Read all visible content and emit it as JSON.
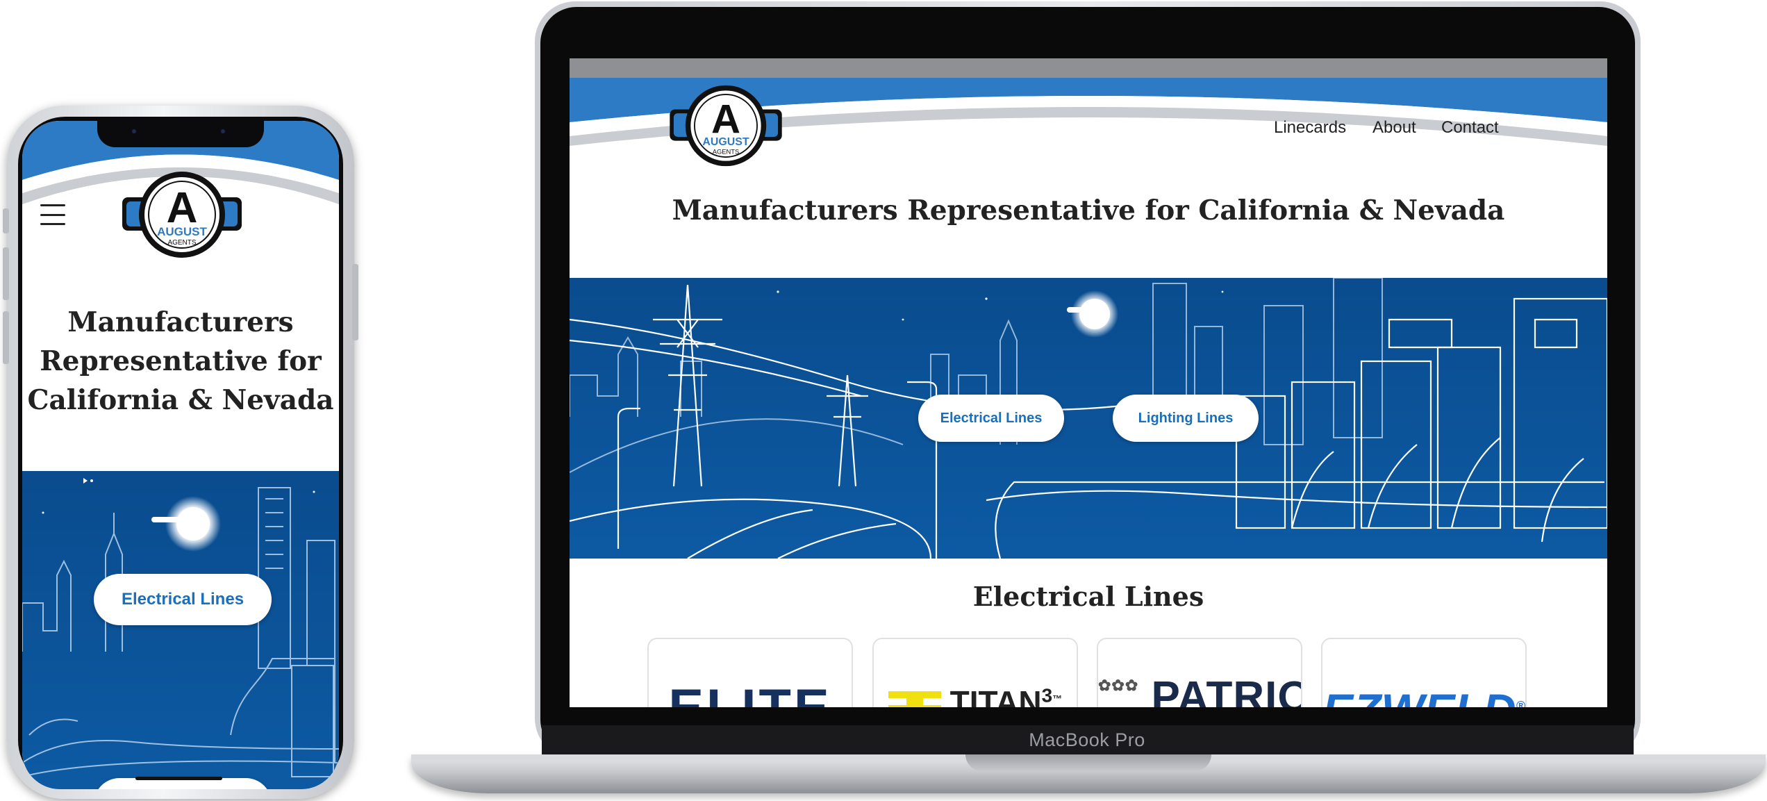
{
  "brand": {
    "letter": "A",
    "name": "AUGUST",
    "sub": "AGENTS"
  },
  "nav": {
    "links": [
      "Linecards",
      "About",
      "Contact"
    ]
  },
  "hero": {
    "title": "Manufacturers Representative for California & Nevada",
    "title_mobile_lines": [
      "Manufacturers",
      "Representative for",
      "California & Nevada"
    ],
    "buttons": [
      "Electrical Lines",
      "Lighting Lines"
    ]
  },
  "section": {
    "title": "Electrical Lines"
  },
  "manufacturers": [
    {
      "name": "ELITE",
      "color": "#16315e"
    },
    {
      "name": "TITAN",
      "suffix": "3",
      "tm": "™",
      "color": "#222222",
      "accent": "#f0e010"
    },
    {
      "name": "PATRIOT",
      "color": "#1a2a4a"
    },
    {
      "name": "EZWELD",
      "reg": "®",
      "color": "#1f6fd0"
    }
  ],
  "device": {
    "laptop_label": "MacBook Pro"
  },
  "colors": {
    "brand_blue": "#2c7bc4",
    "hero_blue": "#0b4d8f",
    "link_blue": "#1a6fbd",
    "text_dark": "#222222"
  },
  "icons": {
    "menu": "hamburger-menu-icon"
  }
}
